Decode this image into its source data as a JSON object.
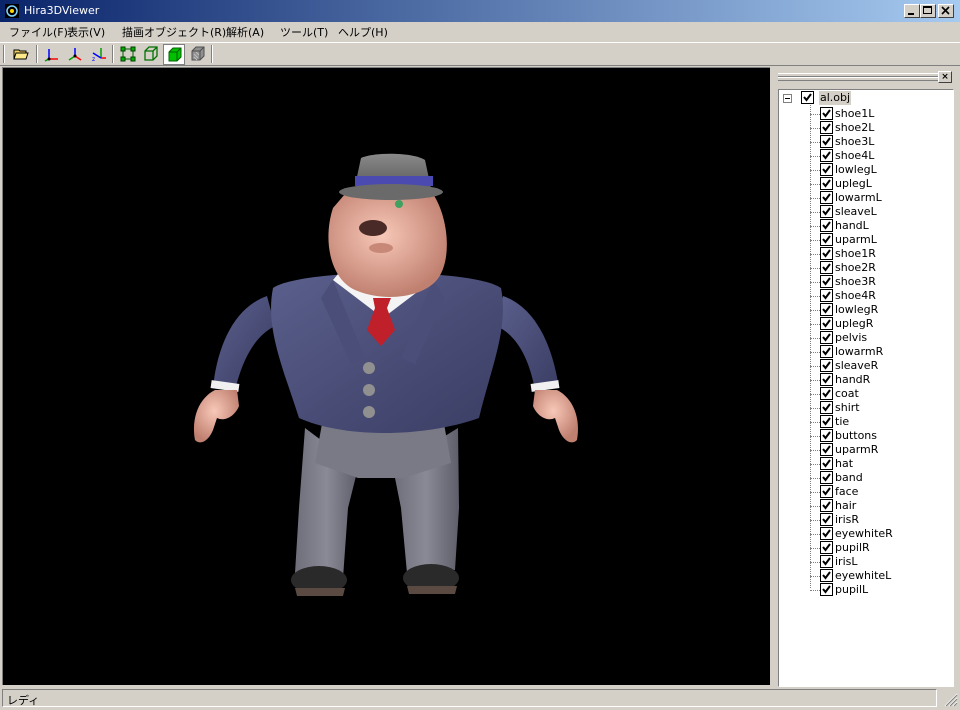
{
  "window": {
    "title": "Hira3DViewer"
  },
  "menu": [
    "ファイル(F)",
    "表示(V)",
    "描画オブジェクト(R)",
    "解析(A)",
    "ツール(T)",
    "ヘルプ(H)"
  ],
  "toolbar": {
    "buttons": [
      "open-folder-icon",
      "axis-xy-icon",
      "axis-xz-icon",
      "axis-yz-icon",
      "vertex-mode-icon",
      "wireframe-mode-icon",
      "solid-mode-icon",
      "texture-mode-icon"
    ]
  },
  "panel": {
    "close_label": "×"
  },
  "tree": {
    "root": {
      "label": "al.obj",
      "checked": true
    },
    "items": [
      "shoe1L",
      "shoe2L",
      "shoe3L",
      "shoe4L",
      "lowlegL",
      "uplegL",
      "lowarmL",
      "sleaveL",
      "handL",
      "uparmL",
      "shoe1R",
      "shoe2R",
      "shoe3R",
      "shoe4R",
      "lowlegR",
      "uplegR",
      "pelvis",
      "lowarmR",
      "sleaveR",
      "handR",
      "coat",
      "shirt",
      "tie",
      "buttons",
      "uparmR",
      "hat",
      "band",
      "face",
      "hair",
      "irisR",
      "eyewhiteR",
      "pupilR",
      "irisL",
      "eyewhiteL",
      "pupilL"
    ]
  },
  "status": {
    "text": "レディ"
  }
}
